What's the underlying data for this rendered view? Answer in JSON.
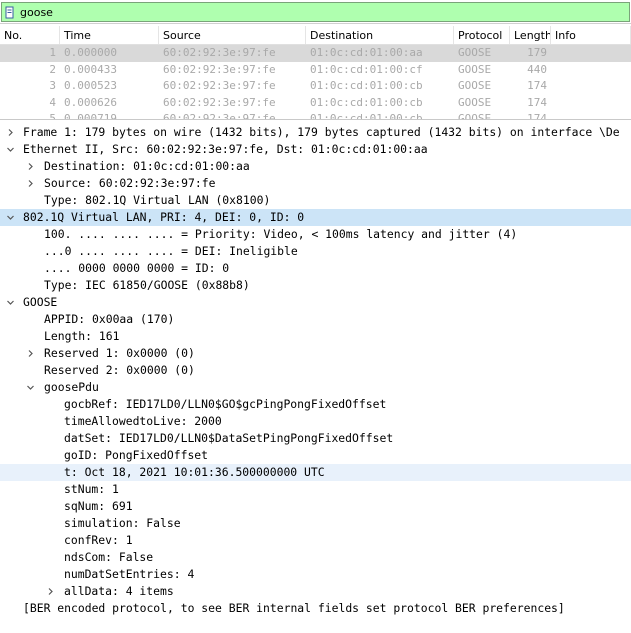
{
  "filter": {
    "value": "goose"
  },
  "packet_list": {
    "columns": [
      "No.",
      "Time",
      "Source",
      "Destination",
      "Protocol",
      "Length",
      "Info"
    ],
    "rows": [
      {
        "no": "1",
        "time": "0.000000",
        "source": "60:02:92:3e:97:fe",
        "destination": "01:0c:cd:01:00:aa",
        "protocol": "GOOSE",
        "length": "179",
        "info": ""
      },
      {
        "no": "2",
        "time": "0.000433",
        "source": "60:02:92:3e:97:fe",
        "destination": "01:0c:cd:01:00:cf",
        "protocol": "GOOSE",
        "length": "440",
        "info": ""
      },
      {
        "no": "3",
        "time": "0.000523",
        "source": "60:02:92:3e:97:fe",
        "destination": "01:0c:cd:01:00:cb",
        "protocol": "GOOSE",
        "length": "174",
        "info": ""
      },
      {
        "no": "4",
        "time": "0.000626",
        "source": "60:02:92:3e:97:fe",
        "destination": "01:0c:cd:01:00:cb",
        "protocol": "GOOSE",
        "length": "174",
        "info": ""
      },
      {
        "no": "5",
        "time": "0.000719",
        "source": "60:02:92:3e:97:fe",
        "destination": "01:0c:cd:01:00:cb",
        "protocol": "GOOSE",
        "length": "174",
        "info": ""
      }
    ]
  },
  "details": [
    {
      "indent": 0,
      "arrow": "collapsed",
      "text": "Frame 1: 179 bytes on wire (1432 bits), 179 bytes captured (1432 bits) on interface \\De"
    },
    {
      "indent": 0,
      "arrow": "expanded",
      "text": "Ethernet II, Src: 60:02:92:3e:97:fe, Dst: 01:0c:cd:01:00:aa"
    },
    {
      "indent": 1,
      "arrow": "collapsed",
      "text": "Destination: 01:0c:cd:01:00:aa"
    },
    {
      "indent": 1,
      "arrow": "collapsed",
      "text": "Source: 60:02:92:3e:97:fe"
    },
    {
      "indent": 1,
      "arrow": "none",
      "text": "Type: 802.1Q Virtual LAN (0x8100)"
    },
    {
      "indent": 0,
      "arrow": "expanded",
      "text": "802.1Q Virtual LAN, PRI: 4, DEI: 0, ID: 0",
      "state": "selected"
    },
    {
      "indent": 1,
      "arrow": "none",
      "text": "100. .... .... .... = Priority: Video, < 100ms latency and jitter (4)"
    },
    {
      "indent": 1,
      "arrow": "none",
      "text": "...0 .... .... .... = DEI: Ineligible"
    },
    {
      "indent": 1,
      "arrow": "none",
      "text": ".... 0000 0000 0000 = ID: 0"
    },
    {
      "indent": 1,
      "arrow": "none",
      "text": "Type: IEC 61850/GOOSE (0x88b8)"
    },
    {
      "indent": 0,
      "arrow": "expanded",
      "text": "GOOSE"
    },
    {
      "indent": 1,
      "arrow": "none",
      "text": "APPID: 0x00aa (170)"
    },
    {
      "indent": 1,
      "arrow": "none",
      "text": "Length: 161"
    },
    {
      "indent": 1,
      "arrow": "collapsed",
      "text": "Reserved 1: 0x0000 (0)"
    },
    {
      "indent": 1,
      "arrow": "none",
      "text": "Reserved 2: 0x0000 (0)"
    },
    {
      "indent": 1,
      "arrow": "expanded",
      "text": "goosePdu"
    },
    {
      "indent": 2,
      "arrow": "none",
      "text": "gocbRef: IED17LD0/LLN0$GO$gcPingPongFixedOffset"
    },
    {
      "indent": 2,
      "arrow": "none",
      "text": "timeAllowedtoLive: 2000"
    },
    {
      "indent": 2,
      "arrow": "none",
      "text": "datSet: IED17LD0/LLN0$DataSetPingPongFixedOffset"
    },
    {
      "indent": 2,
      "arrow": "none",
      "text": "goID: PongFixedOffset"
    },
    {
      "indent": 2,
      "arrow": "none",
      "text": "t: Oct 18, 2021 10:01:36.500000000 UTC",
      "state": "highlight"
    },
    {
      "indent": 2,
      "arrow": "none",
      "text": "stNum: 1"
    },
    {
      "indent": 2,
      "arrow": "none",
      "text": "sqNum: 691"
    },
    {
      "indent": 2,
      "arrow": "none",
      "text": "simulation: False"
    },
    {
      "indent": 2,
      "arrow": "none",
      "text": "confRev: 1"
    },
    {
      "indent": 2,
      "arrow": "none",
      "text": "ndsCom: False"
    },
    {
      "indent": 2,
      "arrow": "none",
      "text": "numDatSetEntries: 4"
    },
    {
      "indent": 2,
      "arrow": "collapsed",
      "text": "allData: 4 items"
    },
    {
      "indent": 0,
      "arrow": "none",
      "text": "[BER encoded protocol, to see BER internal fields set protocol BER preferences]"
    }
  ]
}
